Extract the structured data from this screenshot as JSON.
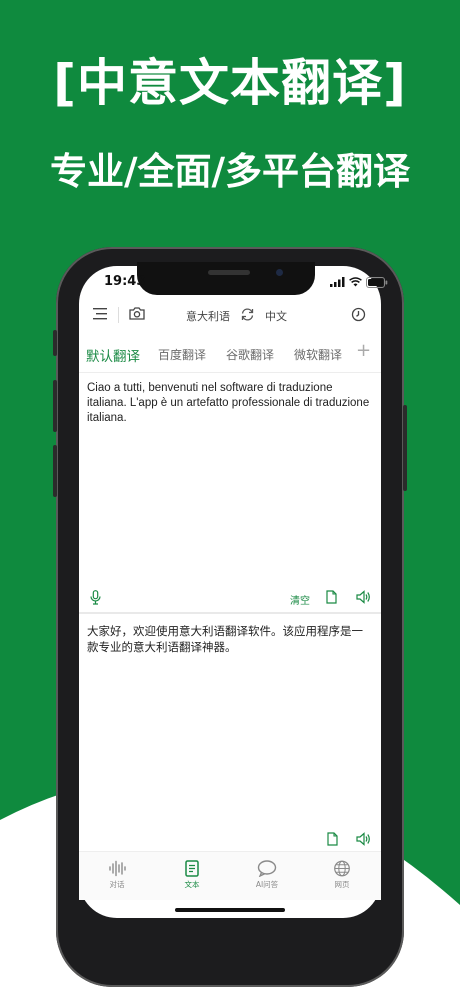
{
  "colors": {
    "brand_green": "#0f8a3e",
    "accent_green": "#1a8a44"
  },
  "promo": {
    "headline": "[中意文本翻译]",
    "subline": "专业/全面/多平台翻译"
  },
  "status_bar": {
    "time": "19:43"
  },
  "toolbar": {
    "source_lang": "意大利语",
    "target_lang": "中文",
    "icons": [
      "menu-icon",
      "camera-icon",
      "swap-icon",
      "history-icon"
    ]
  },
  "engine_tabs": [
    {
      "label": "默认翻译",
      "active": true
    },
    {
      "label": "百度翻译",
      "active": false
    },
    {
      "label": "谷歌翻译",
      "active": false
    },
    {
      "label": "微软翻译",
      "active": false
    }
  ],
  "add_tab_label": "+",
  "source": {
    "text": "Ciao a tutti, benvenuti nel software di traduzione italiana. L'app è un artefatto professionale di traduzione italiana.",
    "clear_label": "清空"
  },
  "target": {
    "text": "大家好，欢迎使用意大利语翻译软件。该应用程序是一款专业的意大利语翻译神器。"
  },
  "bottom_nav": [
    {
      "label": "对话",
      "icon": "waveform-icon",
      "active": false
    },
    {
      "label": "文本",
      "icon": "document-icon",
      "active": true
    },
    {
      "label": "AI问答",
      "icon": "chat-bubble-icon",
      "active": false
    },
    {
      "label": "网页",
      "icon": "globe-icon",
      "active": false
    }
  ]
}
